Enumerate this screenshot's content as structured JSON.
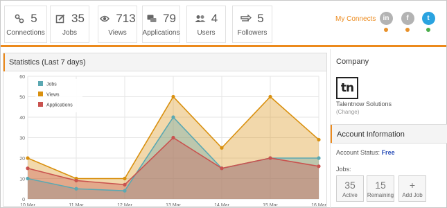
{
  "stats": [
    {
      "icon": "connections-icon",
      "value": "5",
      "label": "Connections"
    },
    {
      "icon": "jobs-icon",
      "value": "35",
      "label": "Jobs"
    },
    {
      "icon": "views-icon",
      "value": "713",
      "label": "Views"
    },
    {
      "icon": "applications-icon",
      "value": "79",
      "label": "Applications"
    },
    {
      "icon": "users-icon",
      "value": "4",
      "label": "Users"
    },
    {
      "icon": "followers-icon",
      "value": "5",
      "label": "Followers"
    }
  ],
  "connects": {
    "label": "My Connects",
    "networks": [
      {
        "icon": "linkedin-icon",
        "glyph": "in",
        "status_color": "#e8912a"
      },
      {
        "icon": "facebook-icon",
        "glyph": "f",
        "status_color": "#e8912a"
      },
      {
        "icon": "twitter-icon",
        "glyph": "t",
        "status_color": "#4cae4c"
      }
    ]
  },
  "statistics": {
    "title": "Statistics (Last 7 days)"
  },
  "chart_data": {
    "type": "area",
    "categories": [
      "10 Mar",
      "11 Mar",
      "12 Mar",
      "13 Mar",
      "14 Mar",
      "15 Mar",
      "16 Mar"
    ],
    "ylim": [
      0,
      60
    ],
    "yticks": [
      0,
      10,
      20,
      30,
      40,
      50,
      60
    ],
    "grid": true,
    "legend_position": "top-left",
    "series": [
      {
        "name": "Jobs",
        "color": "#5ba8b2",
        "values": [
          10,
          5,
          4,
          40,
          15,
          20,
          20
        ]
      },
      {
        "name": "Views",
        "color": "#d9900f",
        "values": [
          20,
          10,
          10,
          50,
          25,
          50,
          29
        ]
      },
      {
        "name": "Applications",
        "color": "#c9534f",
        "values": [
          15,
          9,
          7,
          30,
          15,
          20,
          16
        ]
      }
    ]
  },
  "company": {
    "title": "Company",
    "logo_text": "tn",
    "name": "Talentnow Solutions",
    "change_label": "(Change)"
  },
  "account": {
    "title": "Account Information",
    "status_label": "Account Status:",
    "status_value": "Free",
    "jobs_label": "Jobs:",
    "boxes": [
      {
        "value": "35",
        "label": "Active"
      },
      {
        "value": "15",
        "label": "Remaining"
      },
      {
        "value": "+",
        "label": "Add Job"
      }
    ]
  }
}
